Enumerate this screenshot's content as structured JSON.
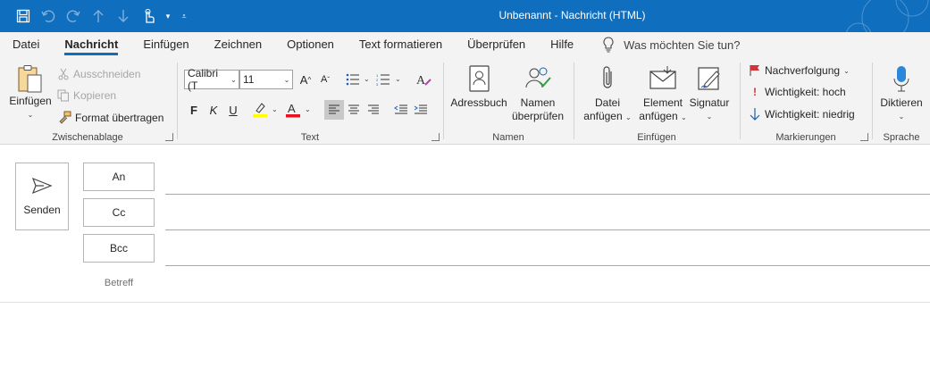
{
  "window": {
    "title": "Unbenannt  -  Nachricht (HTML)"
  },
  "tabs": [
    "Datei",
    "Nachricht",
    "Einfügen",
    "Zeichnen",
    "Optionen",
    "Text formatieren",
    "Überprüfen",
    "Hilfe"
  ],
  "active_tab": "Nachricht",
  "tell_me": "Was möchten Sie tun?",
  "ribbon": {
    "clipboard": {
      "label": "Zwischenablage",
      "paste": "Einfügen",
      "cut": "Ausschneiden",
      "copy": "Kopieren",
      "format_painter": "Format übertragen"
    },
    "text": {
      "label": "Text",
      "font": "Calibri (T",
      "size": "11",
      "bold": "F",
      "italic": "K",
      "underline": "U"
    },
    "names": {
      "label": "Namen",
      "address_book": "Adressbuch",
      "check_names_1": "Namen",
      "check_names_2": "überprüfen"
    },
    "include": {
      "label": "Einfügen",
      "attach_file_1": "Datei",
      "attach_file_2": "anfügen",
      "attach_item_1": "Element",
      "attach_item_2": "anfügen",
      "signature": "Signatur"
    },
    "tags": {
      "label": "Markierungen",
      "follow_up": "Nachverfolgung",
      "high": "Wichtigkeit: hoch",
      "low": "Wichtigkeit: niedrig"
    },
    "voice": {
      "label": "Sprache",
      "dictate": "Diktieren"
    }
  },
  "compose": {
    "send": "Senden",
    "to": "An",
    "cc": "Cc",
    "bcc": "Bcc",
    "subject_label": "Betreff"
  },
  "colors": {
    "titlebar": "#106ebe",
    "highlight": "#ffff00",
    "font_color": "#e81123",
    "flag": "#d13438"
  }
}
